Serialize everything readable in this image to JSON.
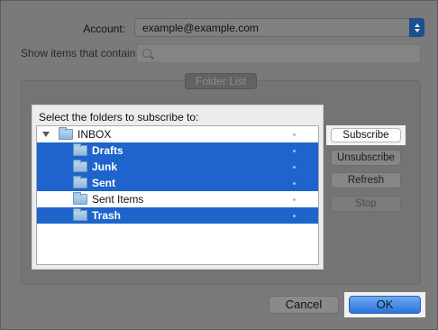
{
  "account": {
    "label": "Account:",
    "value": "example@example.com"
  },
  "filter": {
    "label": "Show items that contain:",
    "value": "",
    "icon": "search-icon"
  },
  "group_title": "Folder List",
  "panel": {
    "prompt": "Select the folders to subscribe to:",
    "folders": [
      {
        "name": "INBOX",
        "selected": false,
        "level": 0,
        "expanded": true
      },
      {
        "name": "Drafts",
        "selected": true,
        "level": 1
      },
      {
        "name": "Junk",
        "selected": true,
        "level": 1
      },
      {
        "name": "Sent",
        "selected": true,
        "level": 1
      },
      {
        "name": "Sent Items",
        "selected": false,
        "level": 1
      },
      {
        "name": "Trash",
        "selected": true,
        "level": 1
      }
    ]
  },
  "buttons": {
    "subscribe": "Subscribe",
    "unsubscribe": "Unsubscribe",
    "refresh": "Refresh",
    "stop": "Stop",
    "cancel": "Cancel",
    "ok": "OK"
  },
  "colors": {
    "selection": "#1e64cc",
    "ok_button": "#2d74d6"
  }
}
